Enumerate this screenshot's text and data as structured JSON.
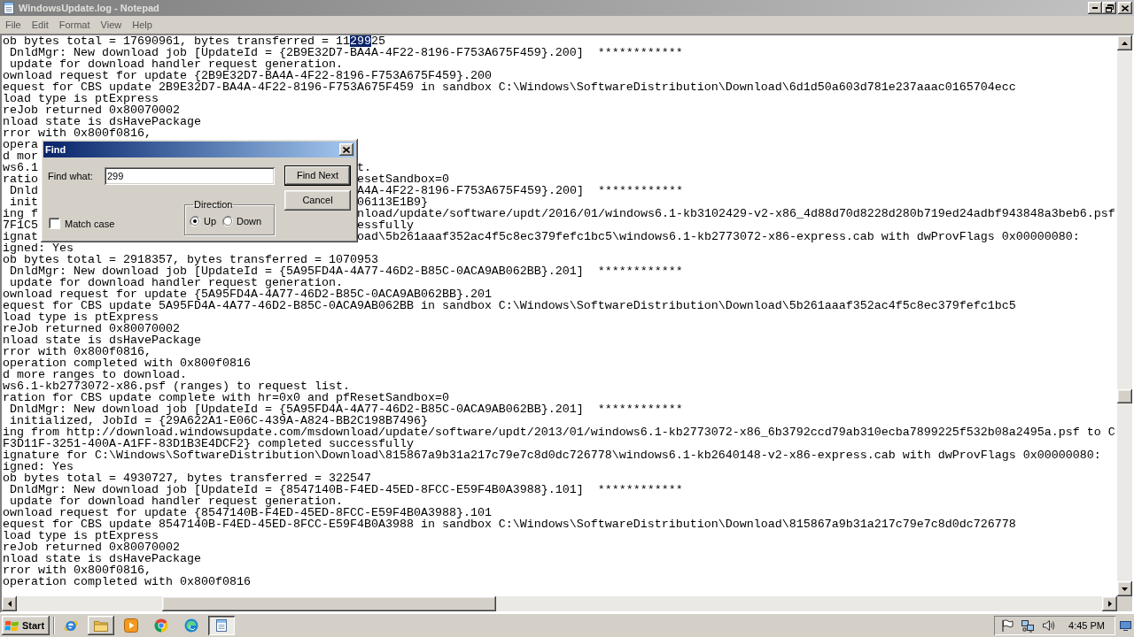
{
  "window": {
    "title": "WindowsUpdate.log - Notepad",
    "active": false
  },
  "menu": [
    "File",
    "Edit",
    "Format",
    "View",
    "Help"
  ],
  "editor": {
    "lines": [
      {
        "kind": "selection",
        "before": "ob bytes total = 17690961, bytes transferred = 11",
        "highlight": "299",
        "after": "25"
      },
      {
        "kind": "plain",
        "text": " DnldMgr: New download job [UpdateId = {2B9E32D7-BA4A-4F22-8196-F753A675F459}.200]  ************"
      },
      {
        "kind": "plain",
        "text": " update for download handler request generation."
      },
      {
        "kind": "plain",
        "text": "ownload request for update {2B9E32D7-BA4A-4F22-8196-F753A675F459}.200"
      },
      {
        "kind": "plain",
        "text": "equest for CBS update 2B9E32D7-BA4A-4F22-8196-F753A675F459 in sandbox C:\\Windows\\SoftwareDistribution\\Download\\6d1d50a603d781e237aaac0165704ecc"
      },
      {
        "kind": "plain",
        "text": "load type is ptExpress"
      },
      {
        "kind": "plain",
        "text": "reJob returned 0x80070002"
      },
      {
        "kind": "plain",
        "text": "nload state is dsHavePackage"
      },
      {
        "kind": "plain",
        "text": "rror with 0x800f0816,"
      },
      {
        "kind": "covered",
        "left": "opera"
      },
      {
        "kind": "covered",
        "left": "d mor"
      },
      {
        "kind": "covered",
        "left": "ws6.1",
        "right": "t."
      },
      {
        "kind": "covered",
        "left": "ratio",
        "right": "esetSandbox=0"
      },
      {
        "kind": "covered",
        "left": " Dnld",
        "right": "A4A-4F22-8196-F753A675F459}.200]  ************"
      },
      {
        "kind": "covered",
        "left": " init",
        "right": "06113E1B9}"
      },
      {
        "kind": "covered",
        "left": "ing f",
        "right": "nload/update/software/updt/2016/01/windows6.1-kb3102429-v2-x86_4d88d70d8228d280b719ed24adbf943848a3beb6.psf"
      },
      {
        "kind": "covered",
        "left": "7F1C5",
        "right": "essfully"
      },
      {
        "kind": "covered",
        "left": "ignat",
        "right": "oad\\5b261aaaf352ac4f5c8ec379fefc1bc5\\windows6.1-kb2773072-x86-express.cab with dwProvFlags 0x00000080:"
      },
      {
        "kind": "plain",
        "text": "igned: Yes"
      },
      {
        "kind": "plain",
        "text": "ob bytes total = 2918357, bytes transferred = 1070953"
      },
      {
        "kind": "plain",
        "text": " DnldMgr: New download job [UpdateId = {5A95FD4A-4A77-46D2-B85C-0ACA9AB062BB}.201]  ************"
      },
      {
        "kind": "plain",
        "text": " update for download handler request generation."
      },
      {
        "kind": "plain",
        "text": "ownload request for update {5A95FD4A-4A77-46D2-B85C-0ACA9AB062BB}.201"
      },
      {
        "kind": "plain",
        "text": "equest for CBS update 5A95FD4A-4A77-46D2-B85C-0ACA9AB062BB in sandbox C:\\Windows\\SoftwareDistribution\\Download\\5b261aaaf352ac4f5c8ec379fefc1bc5"
      },
      {
        "kind": "plain",
        "text": "load type is ptExpress"
      },
      {
        "kind": "plain",
        "text": "reJob returned 0x80070002"
      },
      {
        "kind": "plain",
        "text": "nload state is dsHavePackage"
      },
      {
        "kind": "plain",
        "text": "rror with 0x800f0816,"
      },
      {
        "kind": "plain",
        "text": "operation completed with 0x800f0816"
      },
      {
        "kind": "plain",
        "text": "d more ranges to download."
      },
      {
        "kind": "plain",
        "text": "ws6.1-kb2773072-x86.psf (ranges) to request list."
      },
      {
        "kind": "plain",
        "text": "ration for CBS update complete with hr=0x0 and pfResetSandbox=0"
      },
      {
        "kind": "plain",
        "text": " DnldMgr: New download job [UpdateId = {5A95FD4A-4A77-46D2-B85C-0ACA9AB062BB}.201]  ************"
      },
      {
        "kind": "plain",
        "text": " initialized, JobId = {29A622A1-E06C-439A-A824-BB2C198B7496}"
      },
      {
        "kind": "plain",
        "text": "ing from http://download.windowsupdate.com/msdownload/update/software/updt/2013/01/windows6.1-kb2773072-x86_6b3792ccd79ab310ecba7899225f532b08a2495a.psf to C"
      },
      {
        "kind": "plain",
        "text": "F3D11F-3251-400A-A1FF-83D1B3E4DCF2} completed successfully"
      },
      {
        "kind": "plain",
        "text": "ignature for C:\\Windows\\SoftwareDistribution\\Download\\815867a9b31a217c79e7c8d0dc726778\\windows6.1-kb2640148-v2-x86-express.cab with dwProvFlags 0x00000080:"
      },
      {
        "kind": "plain",
        "text": "igned: Yes"
      },
      {
        "kind": "plain",
        "text": "ob bytes total = 4930727, bytes transferred = 322547"
      },
      {
        "kind": "plain",
        "text": " DnldMgr: New download job [UpdateId = {8547140B-F4ED-45ED-8FCC-E59F4B0A3988}.101]  ************"
      },
      {
        "kind": "plain",
        "text": " update for download handler request generation."
      },
      {
        "kind": "plain",
        "text": "ownload request for update {8547140B-F4ED-45ED-8FCC-E59F4B0A3988}.101"
      },
      {
        "kind": "plain",
        "text": "equest for CBS update 8547140B-F4ED-45ED-8FCC-E59F4B0A3988 in sandbox C:\\Windows\\SoftwareDistribution\\Download\\815867a9b31a217c79e7c8d0dc726778"
      },
      {
        "kind": "plain",
        "text": "load type is ptExpress"
      },
      {
        "kind": "plain",
        "text": "reJob returned 0x80070002"
      },
      {
        "kind": "plain",
        "text": "nload state is dsHavePackage"
      },
      {
        "kind": "plain",
        "text": "rror with 0x800f0816,"
      },
      {
        "kind": "plain",
        "text": "operation completed with 0x800f0816"
      }
    ]
  },
  "find_dialog": {
    "title": "Find",
    "active": true,
    "find_what": {
      "label": "Find what:",
      "value": "299"
    },
    "buttons": [
      {
        "label": "Find Next",
        "default": true
      },
      {
        "label": "Cancel",
        "default": false
      }
    ],
    "direction": {
      "label": "Direction",
      "options": [
        {
          "label": "Up",
          "selected": true
        },
        {
          "label": "Down",
          "selected": false
        }
      ]
    },
    "match_case": {
      "label": "Match case",
      "checked": false
    }
  },
  "taskbar": {
    "start": "Start",
    "apps": [
      {
        "kind": "globe",
        "open": false,
        "pressed": false
      },
      {
        "kind": "folder",
        "open": true,
        "pressed": false
      },
      {
        "kind": "play",
        "open": false,
        "pressed": false
      },
      {
        "kind": "tricolor",
        "open": false,
        "pressed": false
      },
      {
        "kind": "swirl",
        "open": false,
        "pressed": false
      },
      {
        "kind": "notepad",
        "open": true,
        "pressed": true
      }
    ],
    "clock": "4:45 PM"
  }
}
